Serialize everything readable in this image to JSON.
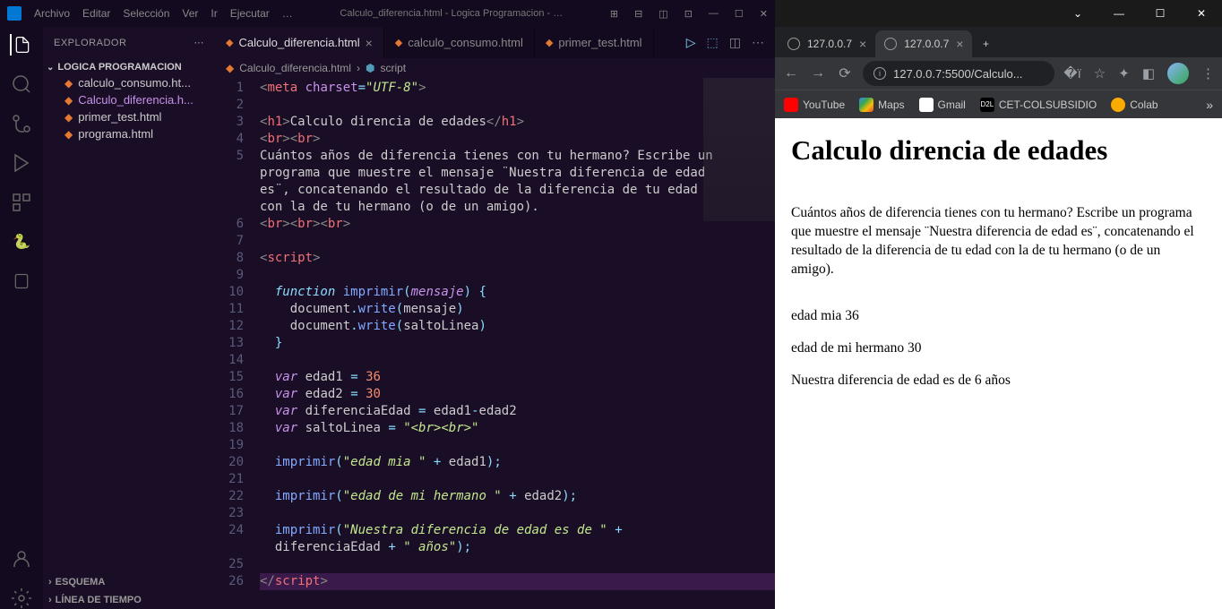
{
  "vscode": {
    "menu": [
      "Archivo",
      "Editar",
      "Selección",
      "Ver",
      "Ir",
      "Ejecutar",
      "…"
    ],
    "window_title": "Calculo_diferencia.html - Logica Programacion - …",
    "explorer_label": "EXPLORADOR",
    "project_name": "LOGICA PROGRAMACION",
    "files": [
      {
        "name": "calculo_consumo.ht..."
      },
      {
        "name": "Calculo_diferencia.h..."
      },
      {
        "name": "primer_test.html"
      },
      {
        "name": "programa.html"
      }
    ],
    "outline_label": "ESQUEMA",
    "timeline_label": "LÍNEA DE TIEMPO",
    "tabs": [
      {
        "name": "Calculo_diferencia.html",
        "active": true,
        "close": true
      },
      {
        "name": "calculo_consumo.html",
        "active": false
      },
      {
        "name": "primer_test.html",
        "active": false
      }
    ],
    "breadcrumb": {
      "file": "Calculo_diferencia.html",
      "sym": "script"
    }
  },
  "browser": {
    "tabs": [
      {
        "label": "127.0.0.7",
        "active": false
      },
      {
        "label": "127.0.0.7",
        "active": true
      }
    ],
    "url": "127.0.0.7:5500/Calculo...",
    "bookmarks": [
      {
        "name": "YouTube",
        "cls": "yt"
      },
      {
        "name": "Maps",
        "cls": "mp"
      },
      {
        "name": "Gmail",
        "cls": "gm"
      },
      {
        "name": "CET-COLSUBSIDIO",
        "cls": "d2l",
        "txt": "D2L"
      },
      {
        "name": "Colab",
        "cls": "co"
      }
    ],
    "page": {
      "h1": "Calculo direncia de edades",
      "para": "Cuántos años de diferencia tienes con tu hermano? Escribe un programa que muestre el mensaje ¨Nuestra diferencia de edad es¨, concatenando el resultado de la diferencia de tu edad con la de tu hermano (o de un amigo).",
      "out1": "edad mia 36",
      "out2": "edad de mi hermano 30",
      "out3": "Nuestra diferencia de edad es de 6 años"
    }
  }
}
